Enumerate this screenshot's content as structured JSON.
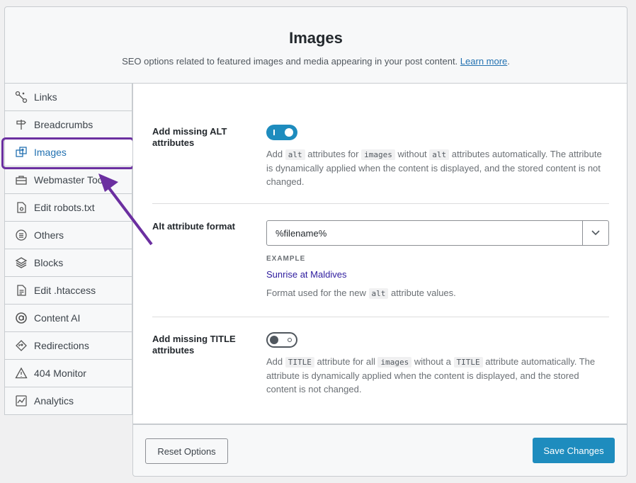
{
  "header": {
    "title": "Images",
    "subtitle": "SEO options related to featured images and media appearing in your post content.",
    "learn_more": "Learn more",
    "period": "."
  },
  "sidebar": {
    "items": [
      {
        "label": "Links",
        "icon": "links-icon"
      },
      {
        "label": "Breadcrumbs",
        "icon": "signpost-icon"
      },
      {
        "label": "Images",
        "icon": "images-icon",
        "active": true
      },
      {
        "label": "Webmaster Tools",
        "icon": "toolbox-icon"
      },
      {
        "label": "Edit robots.txt",
        "icon": "robot-file-icon"
      },
      {
        "label": "Others",
        "icon": "list-circle-icon"
      },
      {
        "label": "Blocks",
        "icon": "blocks-icon"
      },
      {
        "label": "Edit .htaccess",
        "icon": "file-lines-icon"
      },
      {
        "label": "Content AI",
        "icon": "content-ai-icon"
      },
      {
        "label": "Redirections",
        "icon": "redirections-icon"
      },
      {
        "label": "404 Monitor",
        "icon": "warning-icon"
      },
      {
        "label": "Analytics",
        "icon": "analytics-icon"
      }
    ]
  },
  "settings": {
    "alt": {
      "label": "Add missing ALT attributes",
      "enabled": true,
      "desc": [
        "Add ",
        "alt",
        " attributes for ",
        "images",
        " without ",
        "alt",
        " attributes automatically. The attribute is dynamically applied when the content is displayed, and the stored content is not changed."
      ]
    },
    "alt_format": {
      "label": "Alt attribute format",
      "value": "%filename%",
      "example_label": "EXAMPLE",
      "example_value": "Sunrise at Maldives",
      "desc": [
        "Format used for the new ",
        "alt",
        " attribute values."
      ]
    },
    "title": {
      "label": "Add missing TITLE attributes",
      "enabled": false,
      "desc": [
        "Add ",
        "TITLE",
        " attribute for all ",
        "images",
        " without a ",
        "TITLE",
        " attribute automatically. The attribute is dynamically applied when the content is displayed, and the stored content is not changed."
      ]
    }
  },
  "footer": {
    "reset_label": "Reset Options",
    "save_label": "Save Changes"
  },
  "colors": {
    "accent": "#1e8cbe",
    "highlight": "#6b2fa0",
    "link": "#2271b1"
  }
}
